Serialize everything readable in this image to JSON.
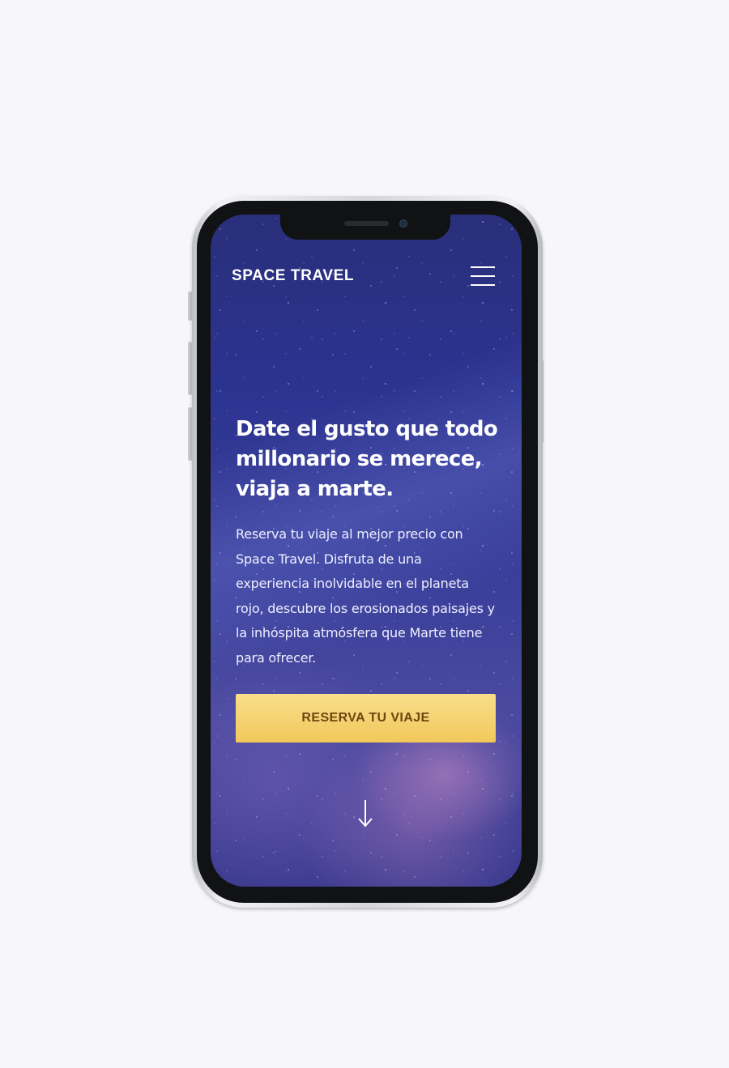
{
  "app": {
    "brand": "SPACE TRAVEL"
  },
  "hero": {
    "headline": "Date el gusto que todo millonario se merece, viaja a marte.",
    "body": "Reserva tu viaje al mejor precio con Space Travel. Disfruta de una experiencia inolvidable en el planeta rojo, descubre los erosionados paisajes y la inhóspita atmósfera que Marte tiene para ofrecer.",
    "cta_label": "RESERVA TU VIAJE"
  },
  "icons": {
    "menu": "hamburger-menu-icon",
    "scroll": "arrow-down-icon"
  },
  "colors": {
    "page_background": "#f7f7f9",
    "cta_top": "#f8df8c",
    "cta_bottom": "#f1c85a",
    "cta_text": "#6e4511",
    "text": "#ffffff",
    "sky": "#2b3390"
  }
}
